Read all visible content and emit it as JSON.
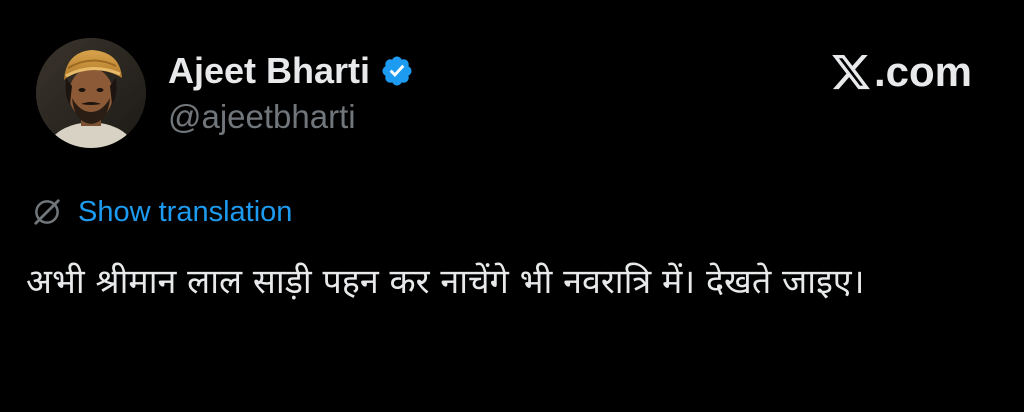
{
  "author": {
    "name": "Ajeet Bharti",
    "handle": "@ajeetbharti",
    "verified": true,
    "verified_color": "#1d9bf0"
  },
  "watermark": {
    "text": ".com",
    "icon": "x-logo-icon"
  },
  "translation": {
    "icon": "globe-slash-icon",
    "label": "Show translation",
    "color": "#1d9bf0"
  },
  "tweet": {
    "text": "अभी श्रीमान लाल साड़ी पहन कर नाचेंगे भी नवरात्रि में। देखते जाइए।"
  },
  "colors": {
    "background": "#000000",
    "primary_text": "#e7e9ea",
    "secondary_text": "#71767b",
    "accent": "#1d9bf0"
  }
}
